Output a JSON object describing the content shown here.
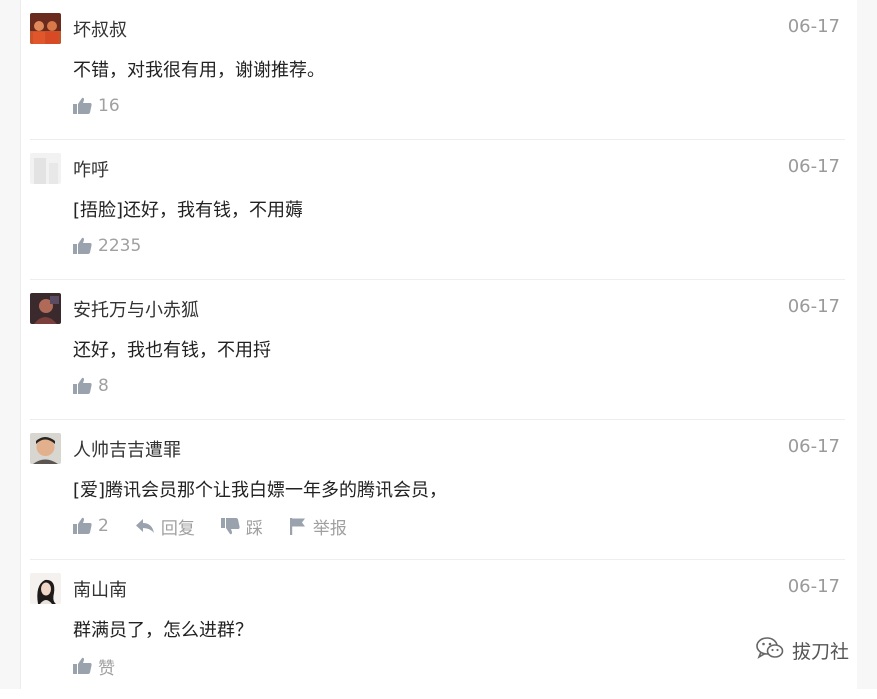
{
  "comments": [
    {
      "name": "坏叔叔",
      "date": "06-17",
      "text": "不错，对我很有用，谢谢推荐。",
      "likes": "16"
    },
    {
      "name": "咋呼",
      "date": "06-17",
      "text": "[捂脸]还好，我有钱，不用薅",
      "likes": "2235"
    },
    {
      "name": "安托万与小赤狐",
      "date": "06-17",
      "text": "还好，我也有钱，不用捋",
      "likes": "8"
    },
    {
      "name": "人帅吉吉遭罪",
      "date": "06-17",
      "text": "[爱]腾讯会员那个让我白嫖一年多的腾讯会员，",
      "likes": "2",
      "reply_label": "回复",
      "dislike_label": "踩",
      "report_label": "举报"
    },
    {
      "name": "南山南",
      "date": "06-17",
      "text": "群满员了，怎么进群？",
      "likes": "赞"
    }
  ],
  "watermark": {
    "text": "拔刀社",
    "icon": "wechat-icon"
  },
  "colors": {
    "meta": "#9a9a9a",
    "icon": "#9aa3ad",
    "divider": "#eeeeee"
  }
}
